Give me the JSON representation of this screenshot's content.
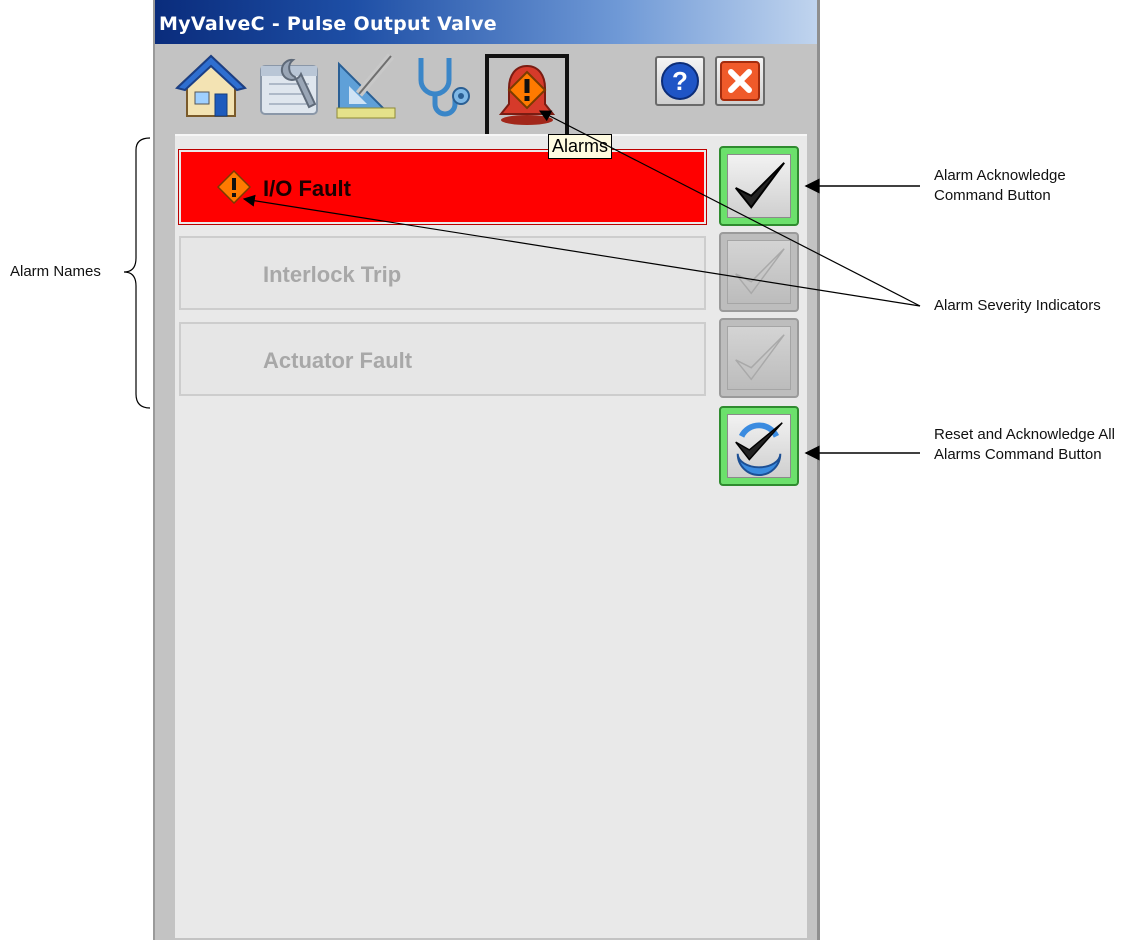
{
  "window": {
    "title": "MyValveC - Pulse Output Valve"
  },
  "toolbar": {
    "tabs": [
      {
        "name": "home",
        "icon": "home-icon"
      },
      {
        "name": "maintenance",
        "icon": "maintenance-icon"
      },
      {
        "name": "engineering",
        "icon": "engineering-icon"
      },
      {
        "name": "diagnostics",
        "icon": "stethoscope-icon"
      },
      {
        "name": "alarms",
        "icon": "alarm-bell-icon",
        "selected": true
      }
    ],
    "help_icon": "help-icon",
    "close_icon": "close-icon",
    "tooltip": "Alarms"
  },
  "alarms": [
    {
      "label": "I/O Fault",
      "active": true,
      "severity_icon": "alarm-severity-icon"
    },
    {
      "label": "Interlock Trip",
      "active": false
    },
    {
      "label": "Actuator Fault",
      "active": false
    }
  ],
  "colors": {
    "active_alarm": "#ff0000",
    "ack_enabled_border": "#6ce06c",
    "severity_orange": "#ff7a00"
  },
  "annotations": {
    "alarm_names": "Alarm Names",
    "ack_button_line1": "Alarm Acknowledge",
    "ack_button_line2": "Command Button",
    "severity": "Alarm Severity Indicators",
    "reset_line1": "Reset and Acknowledge All",
    "reset_line2": "Alarms Command Button"
  }
}
